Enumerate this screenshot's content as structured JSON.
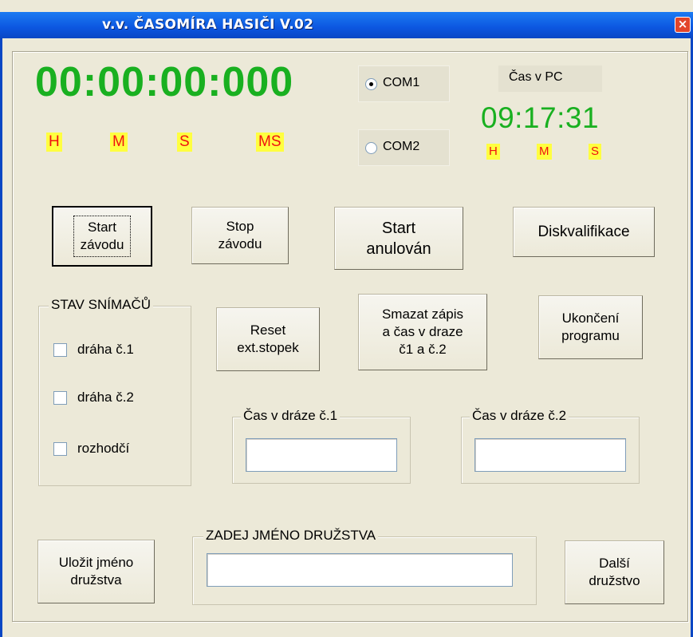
{
  "window": {
    "title": "v.v. ČASOMÍRA HASIČI V.02",
    "close_glyph": "×"
  },
  "stopwatch": {
    "time": "00:00:00:000",
    "labels": {
      "h": "H",
      "m": "M",
      "s": "S",
      "ms": "MS"
    },
    "color": "#19b020"
  },
  "ports": {
    "com1": {
      "label": "COM1",
      "checked": true
    },
    "com2": {
      "label": "COM2",
      "checked": false
    }
  },
  "pc_clock": {
    "label": "Čas v PC",
    "time": "09:17:31",
    "labels": {
      "h": "H",
      "m": "M",
      "s": "S"
    }
  },
  "buttons": {
    "start": "Start\nzávodu",
    "stop": "Stop\nzávodu",
    "start_annulled": "Start\nanulován",
    "disqualify": "Diskvalifikace",
    "reset": "Reset\next.stopek",
    "clear": "Smazat zápis\na čas v draze\nč1 a č.2",
    "quit": "Ukončení\nprogramu",
    "save_team": "Uložit jméno\ndružstva",
    "next_team": "Další\ndružstvo"
  },
  "sensors": {
    "title": "STAV SNÍMAČŮ",
    "items": [
      {
        "label": "dráha č.1",
        "checked": false
      },
      {
        "label": "dráha č.2",
        "checked": false
      },
      {
        "label": "rozhodčí",
        "checked": false
      }
    ]
  },
  "lane_times": {
    "lane1": {
      "title": "Čas v dráze č.1",
      "value": ""
    },
    "lane2": {
      "title": "Čas v dráze č.2",
      "value": ""
    }
  },
  "team": {
    "title": "ZADEJ JMÉNO DRUŽSTVA",
    "value": ""
  },
  "colors": {
    "time_green": "#19b020",
    "label_red": "#f01010",
    "label_yellow": "#ffff40",
    "titlebar_blue": "#0c56e0"
  }
}
